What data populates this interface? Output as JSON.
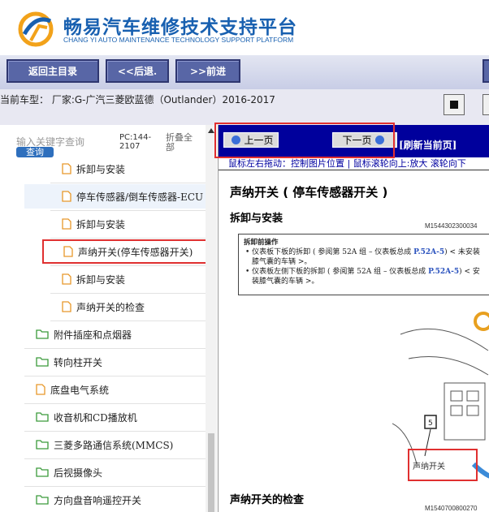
{
  "header": {
    "title": "畅易汽车维修技术支持平台",
    "subtitle": "CHANG YI AUTO MAINTENANCE TECHNOLOGY SUPPORT PLATFORM"
  },
  "toolbar": {
    "home_label": "返回主目录",
    "back_label": "<<后退.",
    "forward_label": ">>前进"
  },
  "car_info": "当前车型：  厂家:G-广汽三菱欧蓝德（Outlander）2016-2017",
  "search": {
    "placeholder": "输入关键字查询",
    "button_label": "查询",
    "pc_label": "PC:144-2107",
    "collapse_label": "折叠全部"
  },
  "tree": [
    {
      "label": "拆卸与安装",
      "type": "doc",
      "level": 2
    },
    {
      "label": "停车传感器/倒车传感器-ECU",
      "type": "doc",
      "level": 2,
      "highlighted": true
    },
    {
      "label": "拆卸与安装",
      "type": "doc",
      "level": 2
    },
    {
      "label": "声纳开关(停车传感器开关)",
      "type": "doc",
      "level": 2,
      "selected": true
    },
    {
      "label": "拆卸与安装",
      "type": "doc",
      "level": 2
    },
    {
      "label": "声纳开关的检查",
      "type": "doc",
      "level": 2
    },
    {
      "label": "附件插座和点烟器",
      "type": "folder",
      "level": 1
    },
    {
      "label": "转向柱开关",
      "type": "folder",
      "level": 1
    },
    {
      "label": "底盘电气系统",
      "type": "doc",
      "level": 1
    },
    {
      "label": "收音机和CD播放机",
      "type": "folder",
      "level": 1
    },
    {
      "label": "三菱多路通信系统(MMCS)",
      "type": "folder",
      "level": 1
    },
    {
      "label": "后视摄像头",
      "type": "folder",
      "level": 1
    },
    {
      "label": "方向盘音响遥控开关",
      "type": "folder",
      "level": 1
    }
  ],
  "docnav": {
    "prev_label": "上一页",
    "next_label": "下一页",
    "refresh_label": "[刷新当前页]",
    "hint": "鼠标左右拖动：控制图片位置 | 鼠标滚轮向上:放大   滚轮向下"
  },
  "doc": {
    "title": "声纳开关 ( 停车传感器开关 )",
    "section1": "拆卸与安装",
    "code1": "M1544302300034",
    "prep_title": "拆卸前操作",
    "prep_item1_a": "仪表板下板的拆卸 ( 参阅第 52A 组 – 仪表板总成 ",
    "prep_item1_link": "P.52A-5",
    "prep_item1_b": ") < 未安装膝气囊的车辆 >。",
    "prep_item2_a": "仪表板左侧下板的拆卸 ( 参阅第 52A 组 – 仪表板总成 ",
    "prep_item2_link": "P.52A-5",
    "prep_item2_b": ") < 安装膝气囊的车辆 >。",
    "illus_caption": "声纳开关",
    "illus_number": "5",
    "section2": "声纳开关的检查",
    "code2": "M1540700800270"
  },
  "colors": {
    "brand_blue": "#1860b0",
    "toolbar_button": "#5866a6",
    "nav_bar": "#00009c",
    "highlight_red": "#e03030",
    "search_button": "#2e6fbd"
  }
}
